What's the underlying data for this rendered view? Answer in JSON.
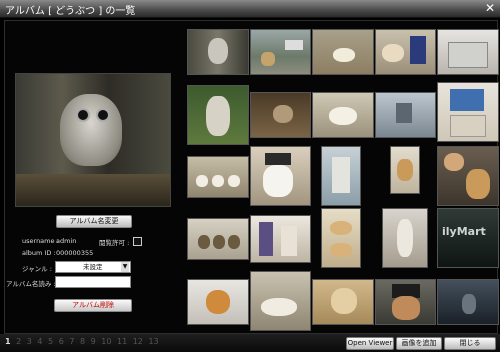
{
  "window": {
    "title": "アルバム [ どうぶつ ] の一覧",
    "close_glyph": "✕"
  },
  "album": {
    "rename_label": "アルバム名変更",
    "username_label": "username :",
    "username_value": "admin",
    "permission_label": "閲覧許可 :",
    "album_id_label": "album ID :",
    "album_id_value": "000000355",
    "genre_label": "ジャンル :",
    "genre_value": "未設定",
    "yomi_label": "アルバム名読み :",
    "yomi_value": "",
    "delete_label": "アルバム削除"
  },
  "pagination": {
    "pages": [
      "1",
      "2",
      "3",
      "4",
      "5",
      "6",
      "7",
      "8",
      "9",
      "10",
      "11",
      "12",
      "13"
    ],
    "current": "1"
  },
  "footer": {
    "open_viewer": "Open Viewer",
    "add_image": "画像を追加",
    "close": "閉じる"
  }
}
